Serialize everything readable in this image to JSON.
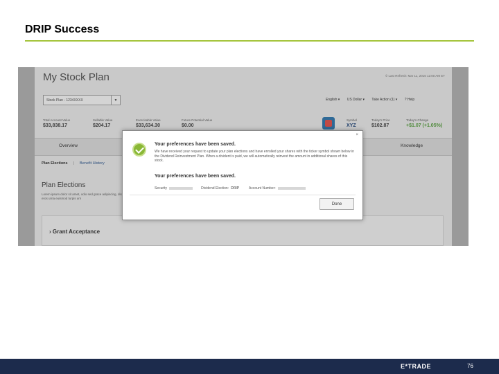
{
  "slide": {
    "title": "DRIP Success",
    "page_number": "76"
  },
  "footer": {
    "logo_text": "E*TRADE"
  },
  "colors": {
    "accent_rule": "#a4c43a",
    "footer_bg": "#1c2b4c",
    "success_green": "#8ab836"
  },
  "app": {
    "title": "My Stock Plan",
    "last_updated": "© Last Refresh: Mar 11, 2016 12:00 AM ET",
    "plan_select": {
      "value": "Stock Plan - 1234XXXX",
      "icon": "chevron-down-icon"
    },
    "top_menu": [
      "English ▾",
      "US Dollar ▾",
      "Take Action (1) ▾",
      "? Help"
    ],
    "metrics": [
      {
        "label": "Total Account Value",
        "value": "$33,838.17"
      },
      {
        "label": "Sellable Value",
        "value": "$204.17"
      },
      {
        "label": "Exercisable Value",
        "value": "$33,634.30"
      },
      {
        "label": "Future Potential Value",
        "value": "$0.00"
      }
    ],
    "stock": {
      "symbol_label": "Symbol",
      "symbol_value": "XYZ",
      "price_label": "Today's Price",
      "price_value": "$102.87",
      "change_label": "Today's Change",
      "change_value": "+$1.07 (+1.05%)"
    },
    "tabs": [
      "Overview",
      "Knowledge"
    ],
    "subnav": {
      "active": "Plan Elections",
      "separator": "|",
      "link": "Benefit History"
    },
    "section_title": "Plan Elections",
    "lorem": "Lorem ipsum dolor sit amet, odio sed grace adipiscing, dis eros urna euismod turpis urn",
    "grant_label": "Grant Acceptance"
  },
  "modal": {
    "close": "×",
    "heading": "Your preferences have been saved.",
    "body": "We have received your request to update your plan elections and have enrolled your shares with the ticker symbol shown below in the Dividend Reinvestment Plan. When a divident is paid, we will automatically reinvest the amount in additional shares of this stock.",
    "subheading": "Your preferences have been saved.",
    "security_label": "Security",
    "election_label": "Dividend Election:",
    "election_value": "DRIP",
    "account_label": "Account Number:",
    "done_label": "Done"
  }
}
